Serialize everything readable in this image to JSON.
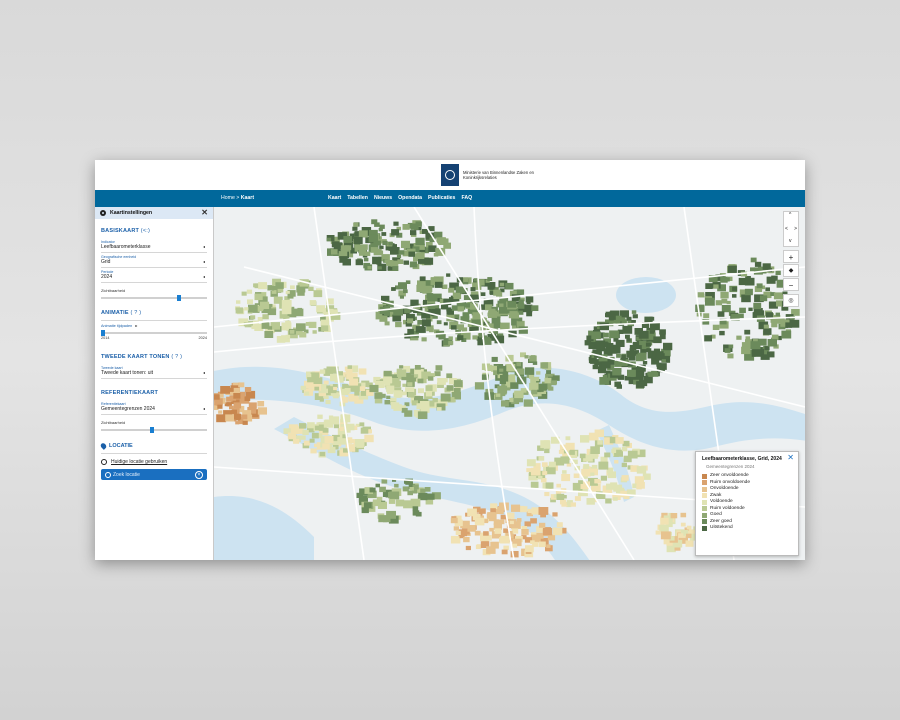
{
  "header": {
    "logo_text": "Ministerie van Binnenlandse Zaken en Koninkrijksrelaties",
    "breadcrumb_home": "Home",
    "breadcrumb_sep": ">",
    "breadcrumb_current": "Kaart",
    "nav": [
      "Kaart",
      "Tabellen",
      "Nieuws",
      "Opendata",
      "Publicaties",
      "FAQ"
    ]
  },
  "sidebar": {
    "title": "Kaartinstellingen",
    "close": "✕",
    "basiskaart": {
      "title": "BASISKAART",
      "title_icon": "share-icon",
      "fields": [
        {
          "label": "Indicator",
          "value": "Leefbaarometerklasse"
        },
        {
          "label": "Geografische eenheid",
          "value": "Grid"
        },
        {
          "label": "Periode",
          "value": "2024"
        }
      ],
      "slider_label": "Zichtbaarheid"
    },
    "animatie": {
      "title": "ANIMATIE",
      "help": "( ? )",
      "label": "Animatie tijdpaden",
      "play": "▸",
      "start": "2014",
      "end": "2024"
    },
    "tweede": {
      "title": "TWEEDE KAART TONEN",
      "help": "( ? )",
      "field_label": "Tweede kaart",
      "field_value": "Tweede kaart tonen: uit"
    },
    "referentie": {
      "title": "REFERENTIEKAART",
      "field_label": "Referentiekaart",
      "field_value": "Gemeentegrenzen 2024",
      "slider_label": "Zichtbaarheid"
    },
    "locatie": {
      "title": "LOCATIE",
      "use_current": "Huidige locatie gebruiken",
      "search_placeholder": "Zoek locatie"
    }
  },
  "map": {
    "controls": [
      "^",
      "<",
      ">",
      "v",
      "+",
      "−"
    ],
    "legend": {
      "title": "Leefbaarometerklasse, Grid, 2024",
      "subtitle": "Gemeentegrenzen 2024",
      "close": "✕",
      "items": [
        {
          "label": "Zeer onvoldoende",
          "color": "#c8874f"
        },
        {
          "label": "Ruim onvoldoende",
          "color": "#daa36f"
        },
        {
          "label": "Onvoldoende",
          "color": "#e7c38f"
        },
        {
          "label": "Zwak",
          "color": "#f1e2b3"
        },
        {
          "label": "Voldoende",
          "color": "#dfe3b4"
        },
        {
          "label": "Ruim voldoende",
          "color": "#b9c993"
        },
        {
          "label": "Goed",
          "color": "#8fa874"
        },
        {
          "label": "Zeer goed",
          "color": "#6b8a5b"
        },
        {
          "label": "Uitstekend",
          "color": "#4b6744"
        }
      ]
    },
    "colors": {
      "water": "#cde3f1",
      "land": "#eef1f2",
      "road": "#ffffff"
    }
  }
}
